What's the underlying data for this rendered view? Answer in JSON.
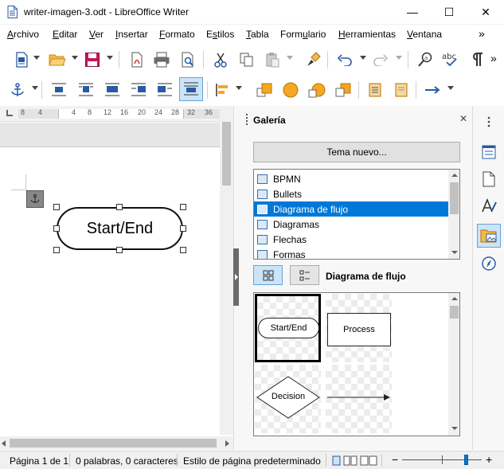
{
  "window": {
    "title": "writer-imagen-3.odt - LibreOffice Writer",
    "minimize_glyph": "—",
    "maximize_glyph": "☐",
    "close_glyph": "✕"
  },
  "menu": {
    "items": [
      {
        "pre": "",
        "accel": "A",
        "post": "rchivo"
      },
      {
        "pre": "",
        "accel": "E",
        "post": "ditar"
      },
      {
        "pre": "",
        "accel": "V",
        "post": "er"
      },
      {
        "pre": "",
        "accel": "I",
        "post": "nsertar"
      },
      {
        "pre": "",
        "accel": "F",
        "post": "ormato"
      },
      {
        "pre": "E",
        "accel": "s",
        "post": "tilos"
      },
      {
        "pre": "",
        "accel": "T",
        "post": "abla"
      },
      {
        "pre": "Form",
        "accel": "u",
        "post": "lario"
      },
      {
        "pre": "",
        "accel": "H",
        "post": "erramientas"
      },
      {
        "pre": "",
        "accel": "V",
        "post": "entana"
      }
    ],
    "overflow": "»"
  },
  "toolbar": {
    "overflow": "»"
  },
  "ruler": {
    "labels": [
      "8",
      "4",
      "4",
      "8",
      "12",
      "16",
      "20",
      "24",
      "28",
      "32",
      "36"
    ]
  },
  "document": {
    "shape_text": "Start/End"
  },
  "gallery": {
    "header": "Galería",
    "close_glyph": "✕",
    "new_theme": "Tema nuevo...",
    "themes": [
      "BPMN",
      "Bullets",
      "Diagrama de flujo",
      "Diagramas",
      "Flechas",
      "Formas"
    ],
    "selected_index": 2,
    "current_theme": "Diagrama de flujo",
    "items": [
      "Start/End",
      "Process",
      "Decision",
      ""
    ]
  },
  "statusbar": {
    "page": "Página 1 de 1",
    "words": "0 palabras, 0 caracteres",
    "page_style": "Estilo de página predeterminado",
    "zoom_minus": "−",
    "zoom_plus": "+"
  }
}
